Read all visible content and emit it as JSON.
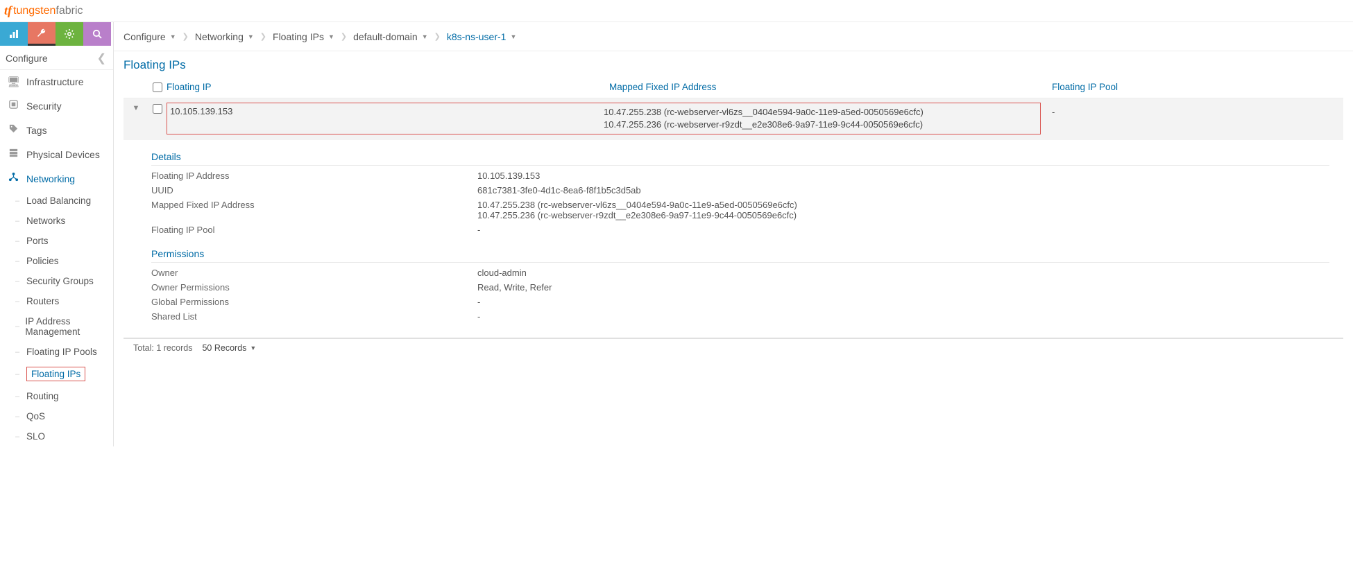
{
  "logo": {
    "brand1": "tungsten",
    "brand2": "fabric"
  },
  "sidebar": {
    "header": "Configure",
    "items": [
      {
        "label": "Infrastructure"
      },
      {
        "label": "Security"
      },
      {
        "label": "Tags"
      },
      {
        "label": "Physical Devices"
      },
      {
        "label": "Networking"
      }
    ],
    "sub_items": [
      {
        "label": "Load Balancing"
      },
      {
        "label": "Networks"
      },
      {
        "label": "Ports"
      },
      {
        "label": "Policies"
      },
      {
        "label": "Security Groups"
      },
      {
        "label": "Routers"
      },
      {
        "label": "IP Address Management"
      },
      {
        "label": "Floating IP Pools"
      },
      {
        "label": "Floating IPs"
      },
      {
        "label": "Routing"
      },
      {
        "label": "QoS"
      },
      {
        "label": "SLO"
      }
    ]
  },
  "breadcrumb": {
    "a": "Configure",
    "b": "Networking",
    "c": "Floating IPs",
    "d": "default-domain",
    "e": "k8s-ns-user-1"
  },
  "page_title": "Floating IPs",
  "table": {
    "headers": {
      "ip": "Floating IP",
      "mapped": "Mapped Fixed IP Address",
      "pool": "Floating IP Pool"
    },
    "row": {
      "ip": "10.105.139.153",
      "mapped1": "10.47.255.238 (rc-webserver-vl6zs__0404e594-9a0c-11e9-a5ed-0050569e6cfc)",
      "mapped2": "10.47.255.236 (rc-webserver-r9zdt__e2e308e6-9a97-11e9-9c44-0050569e6cfc)",
      "pool": "-"
    }
  },
  "details": {
    "title": "Details",
    "rows": {
      "fip_label": "Floating IP Address",
      "fip_value": "10.105.139.153",
      "uuid_label": "UUID",
      "uuid_value": "681c7381-3fe0-4d1c-8ea6-f8f1b5c3d5ab",
      "mapped_label": "Mapped Fixed IP Address",
      "mapped_value1": "10.47.255.238 (rc-webserver-vl6zs__0404e594-9a0c-11e9-a5ed-0050569e6cfc)",
      "mapped_value2": "10.47.255.236 (rc-webserver-r9zdt__e2e308e6-9a97-11e9-9c44-0050569e6cfc)",
      "pool_label": "Floating IP Pool",
      "pool_value": "-"
    }
  },
  "permissions": {
    "title": "Permissions",
    "rows": {
      "owner_label": "Owner",
      "owner_value": "cloud-admin",
      "op_label": "Owner Permissions",
      "op_value": "Read, Write, Refer",
      "gp_label": "Global Permissions",
      "gp_value": "-",
      "sl_label": "Shared List",
      "sl_value": "-"
    }
  },
  "footer": {
    "total": "Total: 1 records",
    "page_size": "50 Records"
  }
}
